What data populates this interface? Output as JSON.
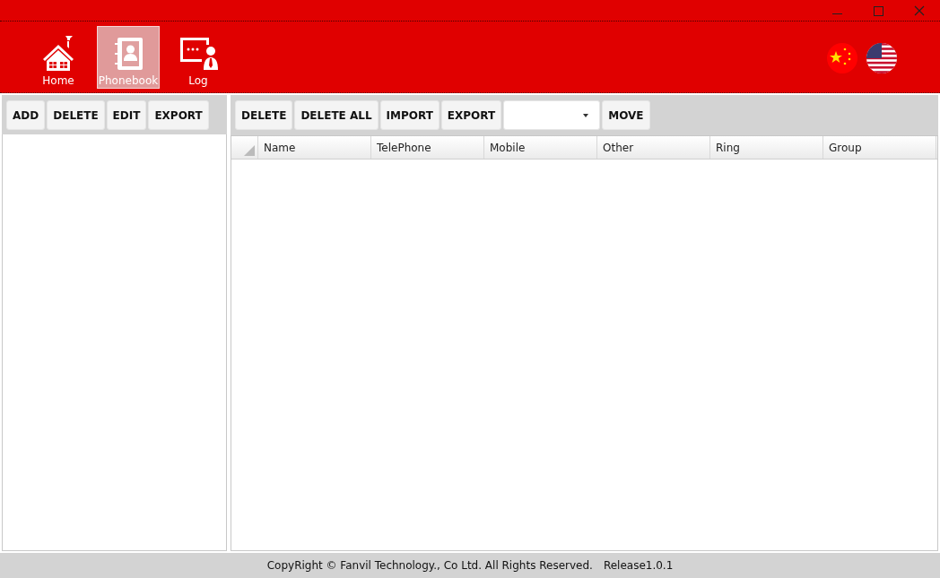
{
  "nav": [
    {
      "label": "Home",
      "kind": "home",
      "selected": false
    },
    {
      "label": "Phonebook",
      "kind": "phonebook",
      "selected": true
    },
    {
      "label": "Log",
      "kind": "log",
      "selected": false
    }
  ],
  "groups_toolbar": [
    {
      "kind": "button",
      "label": "ADD"
    },
    {
      "kind": "button",
      "label": "DELETE"
    },
    {
      "kind": "button",
      "label": "EDIT"
    },
    {
      "kind": "button",
      "label": "EXPORT"
    }
  ],
  "contacts_toolbar": [
    {
      "kind": "button",
      "label": "DELETE"
    },
    {
      "kind": "button",
      "label": "DELETE ALL"
    },
    {
      "kind": "button",
      "label": "IMPORT"
    },
    {
      "kind": "button",
      "label": "EXPORT"
    },
    {
      "kind": "dropdown"
    },
    {
      "kind": "button",
      "label": "MOVE"
    }
  ],
  "table": {
    "columns": [
      "Name",
      "TelePhone",
      "Mobile",
      "Other",
      "Ring",
      "Group"
    ]
  },
  "status_bar": {
    "copyright": "CopyRight © Fanvil Technology., Co Ltd. All Rights Reserved.",
    "release": "Release1.0.1"
  }
}
